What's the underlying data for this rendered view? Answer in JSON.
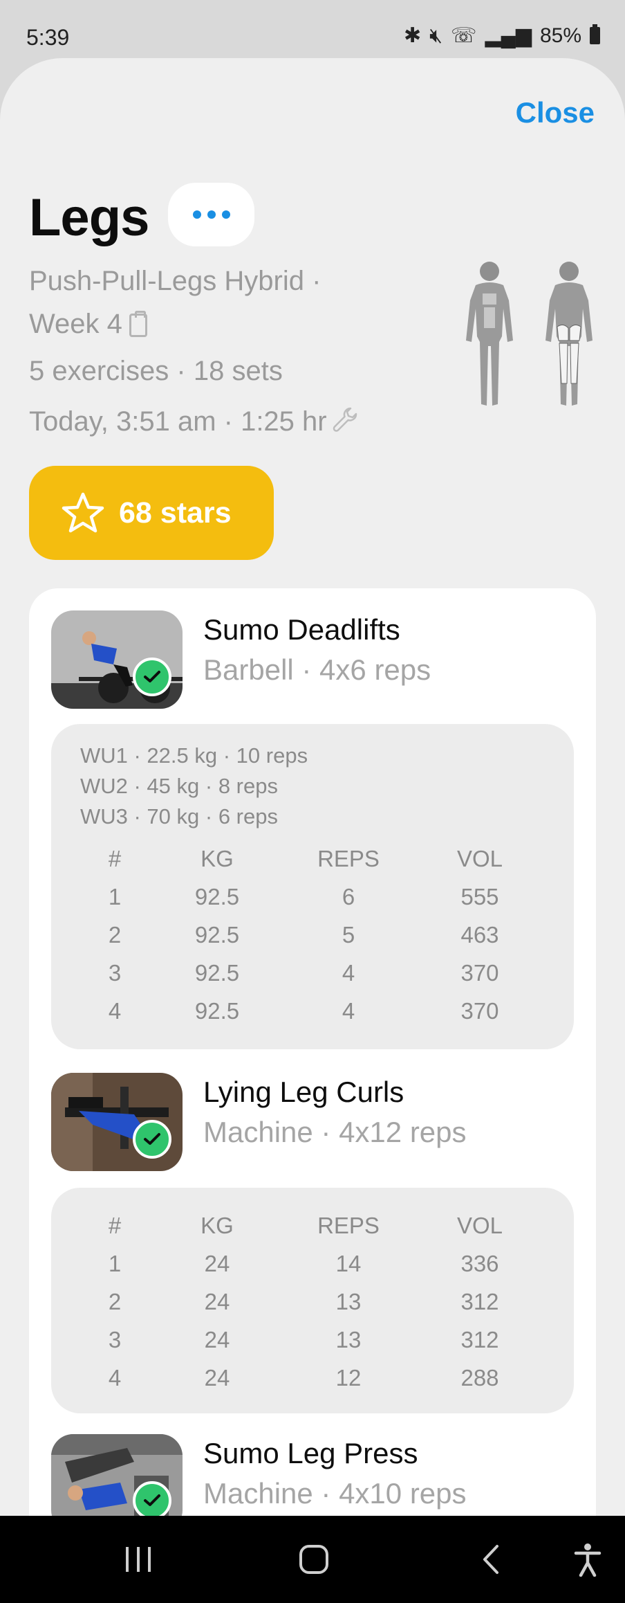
{
  "status_bar": {
    "time": "5:39",
    "battery": "85%"
  },
  "header": {
    "close_label": "Close",
    "title": "Legs"
  },
  "meta": {
    "program": "Push-Pull-Legs Hybrid ·",
    "week": "Week 4",
    "summary": "5 exercises · 18 sets",
    "datetime": "Today, 3:51 am · 1:25 hr"
  },
  "stars": {
    "label": "68 stars"
  },
  "exercises": [
    {
      "name": "Sumo Deadlifts",
      "sub": "Barbell · 4x6 reps",
      "warmups": [
        "WU1 · 22.5 kg · 10 reps",
        "WU2 · 45 kg · 8 reps",
        "WU3 · 70 kg · 6 reps"
      ],
      "columns": [
        "#",
        "KG",
        "REPS",
        "VOL"
      ],
      "sets": [
        [
          "1",
          "92.5",
          "6",
          "555"
        ],
        [
          "2",
          "92.5",
          "5",
          "463"
        ],
        [
          "3",
          "92.5",
          "4",
          "370"
        ],
        [
          "4",
          "92.5",
          "4",
          "370"
        ]
      ]
    },
    {
      "name": "Lying Leg Curls",
      "sub": "Machine · 4x12 reps",
      "warmups": [],
      "columns": [
        "#",
        "KG",
        "REPS",
        "VOL"
      ],
      "sets": [
        [
          "1",
          "24",
          "14",
          "336"
        ],
        [
          "2",
          "24",
          "13",
          "312"
        ],
        [
          "3",
          "24",
          "13",
          "312"
        ],
        [
          "4",
          "24",
          "12",
          "288"
        ]
      ]
    },
    {
      "name": "Sumo Leg Press",
      "sub": "Machine · 4x10 reps"
    }
  ],
  "colors": {
    "accent": "#1a8fe3",
    "stars": "#f4bd0f",
    "check": "#2fc46c"
  }
}
